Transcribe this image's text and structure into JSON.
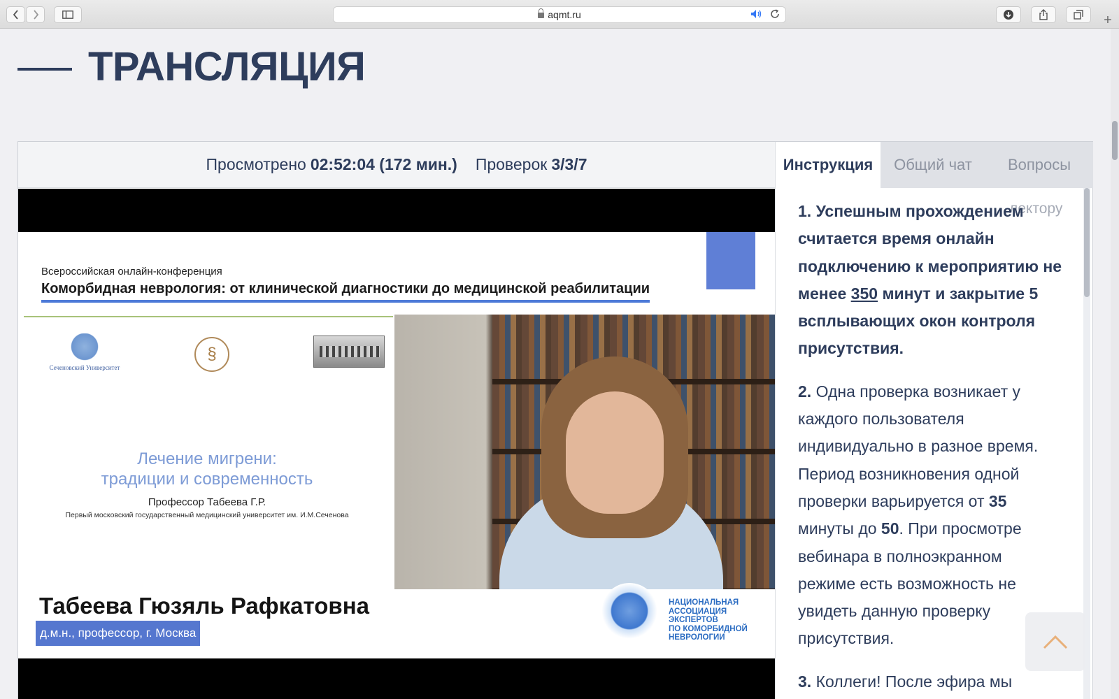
{
  "browser": {
    "url": "aqmt.ru"
  },
  "page": {
    "title": "ТРАНСЛЯЦИЯ"
  },
  "stats": {
    "watched_label": "Просмотрено",
    "watched_value": "02:52:04 (172 мин.)",
    "checks_label": "Проверок",
    "checks_value": "3/3/7"
  },
  "slide": {
    "conf_subtitle": "Всероссийская онлайн-конференция",
    "conf_title": "Коморбидная неврология: от клинической диагностики до медицинской реабилитации",
    "logo_caption": "Сеченовский Университет",
    "lecture_title_line1": "Лечение мигрени:",
    "lecture_title_line2": "традиции и современность",
    "lecture_prof": "Профессор Табеева Г.Р.",
    "lecture_univ": "Первый московский государственный медицинский университет им. И.М.Сеченова",
    "speaker_name": "Табеева Гюзяль Рафкатовна",
    "speaker_role": "д.м.н., профессор, г. Москва",
    "nae_line1": "НАЦИОНАЛЬНАЯ",
    "nae_line2": "АССОЦИАЦИЯ",
    "nae_line3": "ЭКСПЕРТОВ",
    "nae_line4": "ПО КОМОРБИДНОЙ",
    "nae_line5": "НЕВРОЛОГИИ"
  },
  "side": {
    "tabs": [
      "Инструкция",
      "Общий чат",
      "Вопросы"
    ],
    "ghost_text": "лектору",
    "p1_num": "1.",
    "p1_a": "Успешным прохождением считается время онлайн подключению к мероприятию не менее",
    "p1_minutes": "350",
    "p1_b": "минут и закрытие 5 всплывающих окон контроля присутствия.",
    "p2_num": "2.",
    "p2_a": "Одна проверка возникает у каждого пользователя индивидуально в разное время. Период возникновения одной проверки варьируется от",
    "p2_from": "35",
    "p2_b": "минуты до",
    "p2_to": "50",
    "p2_c": ". При просмотре вебинара в полноэкранном режиме есть возможность не увидеть данную проверку присутствия.",
    "p3_num": "3.",
    "p3_a": "Коллеги! После эфира мы"
  }
}
